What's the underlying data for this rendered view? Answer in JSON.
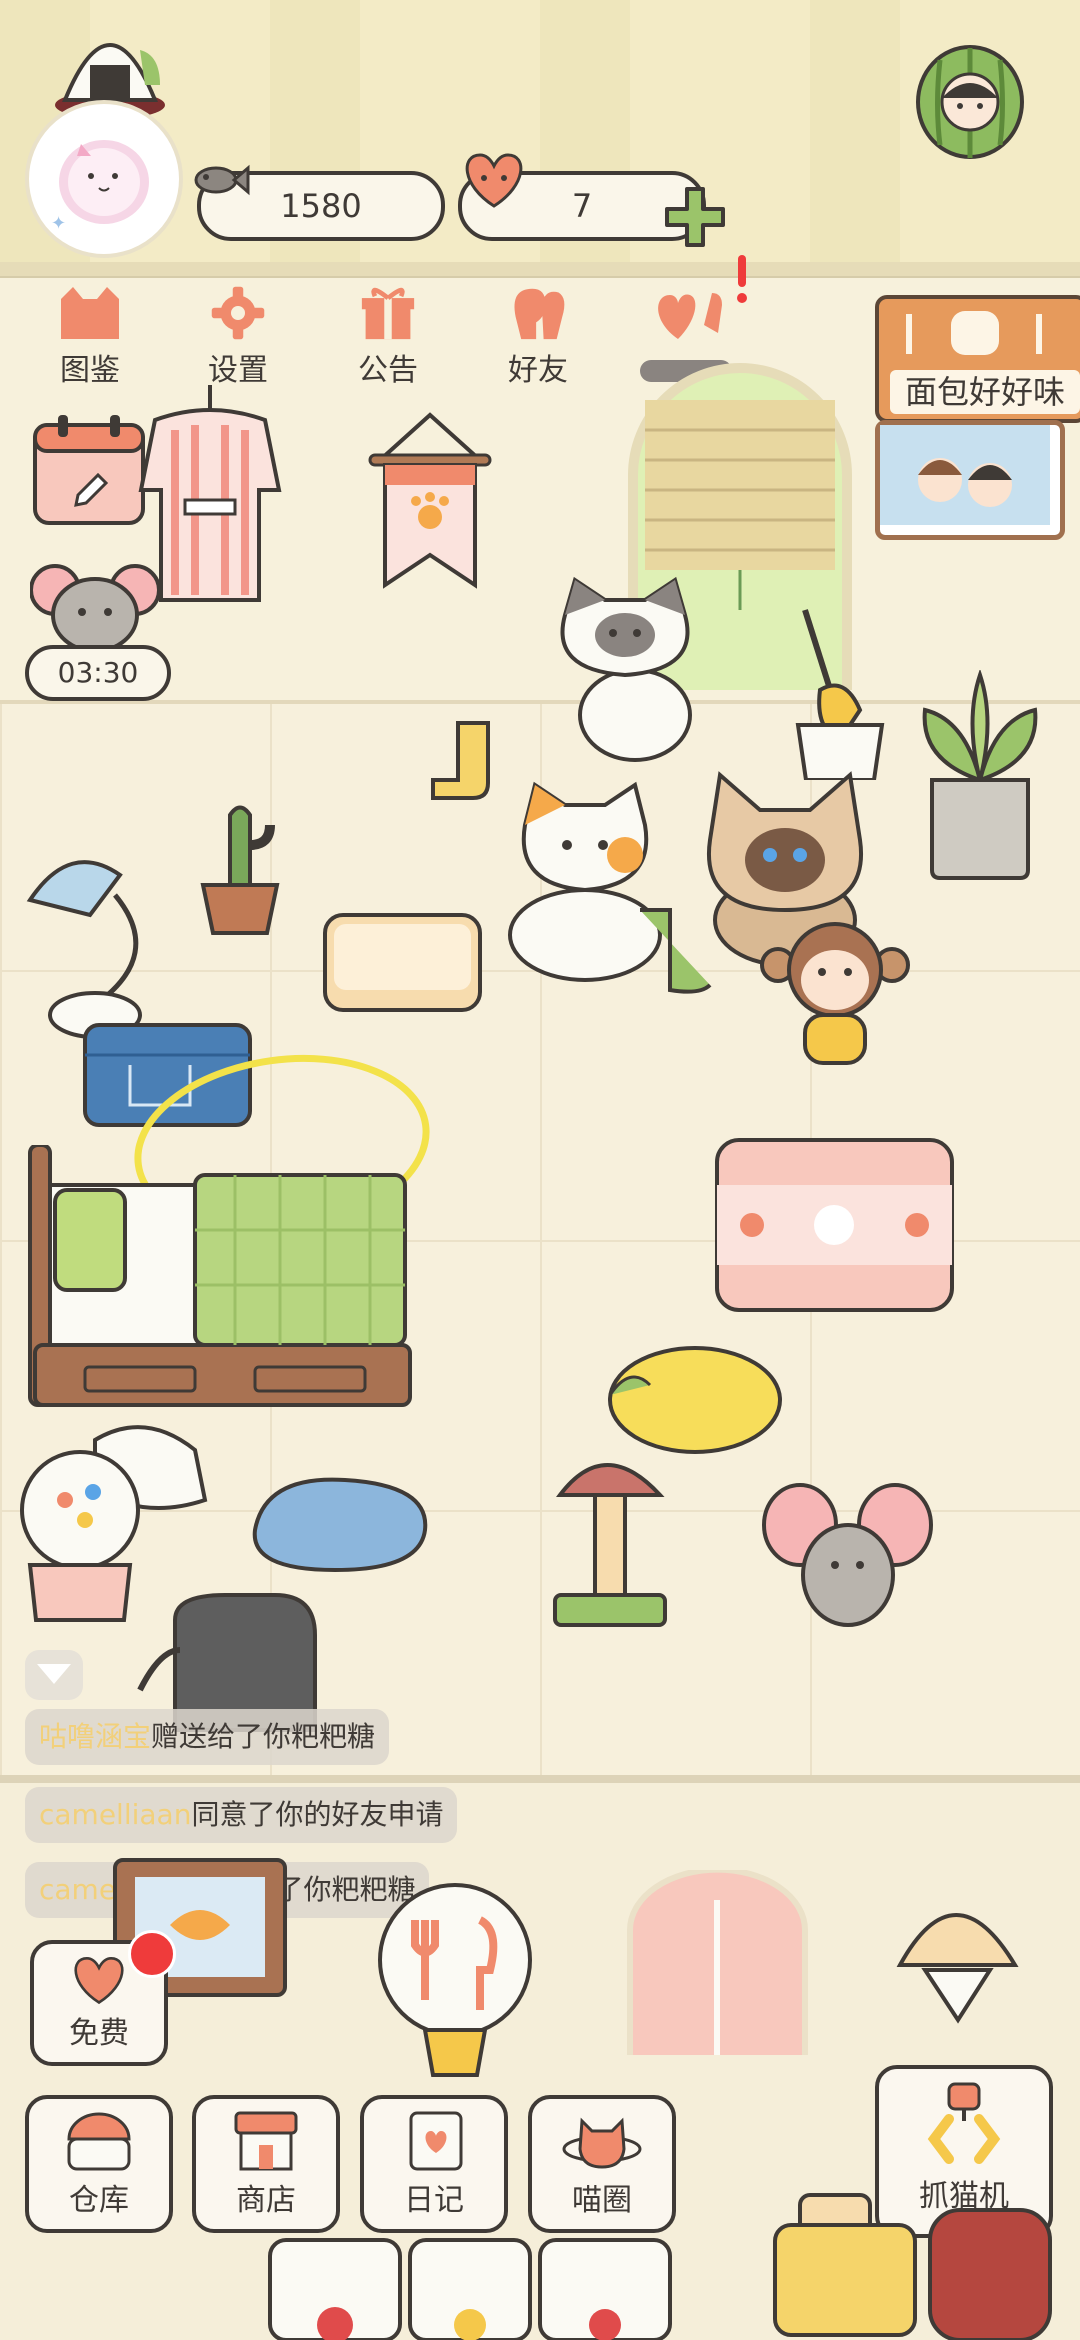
{
  "currency": {
    "fish": "1580",
    "hearts": "7"
  },
  "menu": [
    {
      "label": "图鉴",
      "icon": "cat-book-icon"
    },
    {
      "label": "设置",
      "icon": "gear-icon"
    },
    {
      "label": "公告",
      "icon": "gift-icon"
    },
    {
      "label": "好友",
      "icon": "friends-icon"
    },
    {
      "label": "",
      "icon": "likes-icon"
    }
  ],
  "bread_sign": "面包好好味",
  "timer": "03:30",
  "chat": [
    {
      "name": "咕噜涵宝",
      "text": "赠送给了你粑粑糖"
    },
    {
      "name": "camelliaan",
      "text": "同意了你的好友申请"
    },
    {
      "name": "camelliaan",
      "text": "赠送给了你粑粑糖"
    }
  ],
  "bottom": {
    "free": "免费",
    "warehouse": "仓库",
    "shop": "商店",
    "diary": "日记",
    "circle": "喵圈",
    "claw": "抓猫机"
  },
  "colors": {
    "accent": "#f08a6c",
    "outline": "#3f3a36",
    "chat_name": "#f2d07a",
    "badge": "#ef3b3b"
  }
}
